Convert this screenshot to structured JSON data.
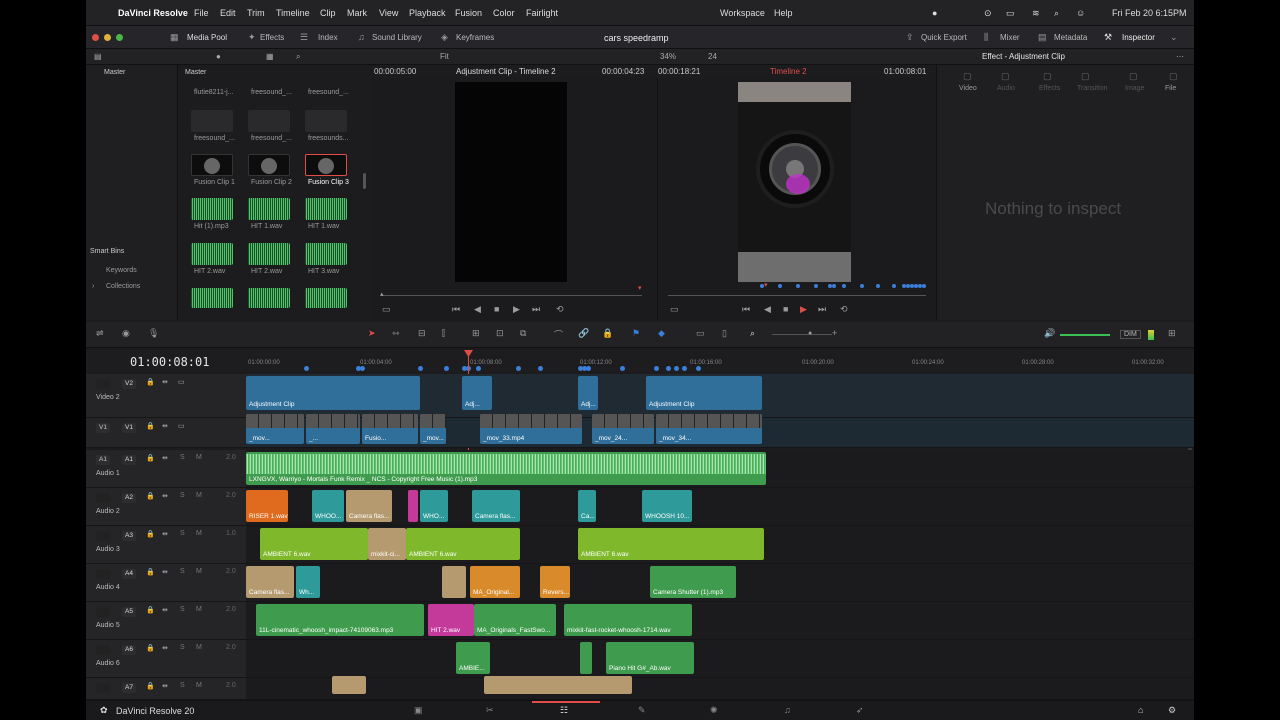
{
  "menubar": {
    "app": "DaVinci Resolve",
    "items": [
      "File",
      "Edit",
      "Trim",
      "Timeline",
      "Clip",
      "Mark",
      "View",
      "Playback",
      "Fusion",
      "Color",
      "Fairlight"
    ],
    "right": [
      "Workspace",
      "Help"
    ],
    "clock": "Fri Feb 20  6:15PM"
  },
  "toolbar": {
    "media_pool": "Media Pool",
    "effects": "Effects",
    "index": "Index",
    "sound_library": "Sound Library",
    "keyframes": "Keyframes",
    "project_title": "cars speedramp",
    "quick_export": "Quick Export",
    "mixer": "Mixer",
    "metadata": "Metadata",
    "inspector": "Inspector"
  },
  "bar2": {
    "fit": "Fit",
    "zoom": "34%",
    "fps": "24",
    "source_tc": "00:00:05:00",
    "source_name": "Adjustment Clip - Timeline 2",
    "source_dur": "00:00:04:23",
    "program_tc": "00:00:18:21",
    "timeline_name": "Timeline 2",
    "program_pos": "01:00:08:01",
    "inspector_title": "Effect - Adjustment Clip"
  },
  "bins": {
    "master_left": "Master",
    "master_header": "Master",
    "smart_bins": "Smart Bins",
    "keywords": "Keywords",
    "collections": "Collections"
  },
  "media": [
    {
      "name": "flutie8211-j..."
    },
    {
      "name": "freesound_..."
    },
    {
      "name": "freesound_..."
    },
    {
      "name": "freesound_..."
    },
    {
      "name": "freesound_..."
    },
    {
      "name": "freesounds..."
    },
    {
      "name": "Fusion Clip 1"
    },
    {
      "name": "Fusion Clip 2"
    },
    {
      "name": "Fusion Clip 3"
    },
    {
      "name": "Hit (1).mp3"
    },
    {
      "name": "HIT 1.wav"
    },
    {
      "name": "HIT 1.wav"
    },
    {
      "name": "HIT 2.wav"
    },
    {
      "name": "HIT 2.wav"
    },
    {
      "name": "HIT 3.wav"
    }
  ],
  "inspector": {
    "tabs": [
      "Video",
      "Audio",
      "Effects",
      "Transition",
      "Image",
      "File"
    ],
    "empty": "Nothing to inspect"
  },
  "timeline": {
    "timecode": "01:00:08:01",
    "ticks": [
      "01:00:00:00",
      "01:00:04:00",
      "01:00:08:00",
      "01:00:12:00",
      "01:00:16:00",
      "01:00:20:00",
      "01:00:24:00",
      "01:00:28:00",
      "01:00:32:00"
    ],
    "dim": "DIM"
  },
  "tracks": [
    {
      "id": "V2",
      "name": "Video 2"
    },
    {
      "id": "V1",
      "name": ""
    },
    {
      "id": "A1",
      "name": "Audio 1",
      "ch": "2.0"
    },
    {
      "id": "A2",
      "name": "Audio 2",
      "ch": "2.0"
    },
    {
      "id": "A3",
      "name": "Audio 3",
      "ch": "1.0"
    },
    {
      "id": "A4",
      "name": "Audio 4",
      "ch": "2.0"
    },
    {
      "id": "A5",
      "name": "Audio 5",
      "ch": "2.0"
    },
    {
      "id": "A6",
      "name": "Audio 6",
      "ch": "2.0"
    },
    {
      "id": "A7",
      "name": "",
      "ch": "2.0"
    }
  ],
  "clips": {
    "v2": [
      "Adjustment Clip",
      "Adj...",
      "Adj...",
      "Adjustment Clip"
    ],
    "v1": [
      "_mov...",
      "_...",
      "Fusio...",
      "_mov...",
      "_mov_33.mp4",
      "_mov_24...",
      "_mov_34..."
    ],
    "a1": "LXNGVX, Warriyo - Mortals Funk Remix _ NCS - Copyright Free Music (1).mp3",
    "a2": [
      "RISER 1.wav",
      "WHOO...",
      "Camera flas...",
      "WHO...",
      "Camera flas...",
      "Ca...",
      "WHOOSH 10..."
    ],
    "a3": [
      "AMBIENT 6.wav",
      "mixkit-ci...",
      "AMBIENT 6.wav",
      "AMBIENT 6.wav"
    ],
    "a4": [
      "Camera flas...",
      "Wh...",
      "MA_Original...",
      "Revers...",
      "Camera Shutter (1).mp3"
    ],
    "a5": [
      "11L-cinematic_whoosh_impact-74109063.mp3",
      "HIT 2.wav",
      "MA_Originals_FastSwo...",
      "mixkit-fast-rocket-whoosh-1714.wav"
    ],
    "a6": [
      "AMBIE...",
      "Piano Hit G#_Ab.wav"
    ]
  },
  "footer": {
    "version": "DaVinci Resolve 20"
  }
}
